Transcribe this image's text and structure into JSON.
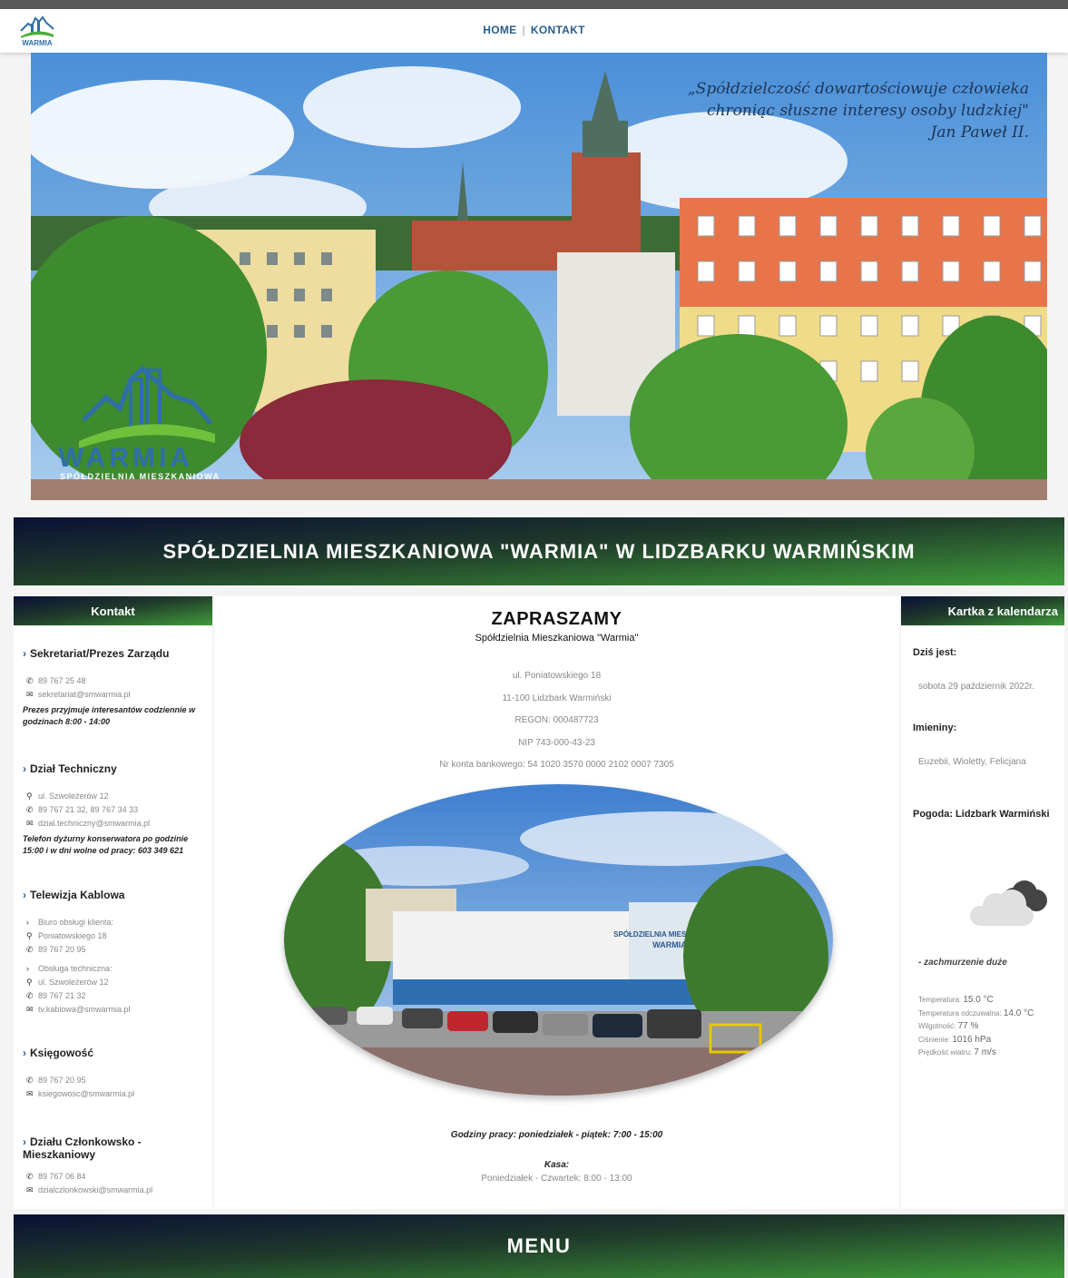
{
  "nav": {
    "home": "HOME",
    "kontakt": "KONTAKT",
    "logo_text": "WARMIA"
  },
  "hero": {
    "quote_line1": "„Spółdzielczość dowartościowuje człowieka",
    "quote_line2": "chroniąc słuszne interesy osoby ludzkiej\"",
    "quote_author": "Jan Paweł II.",
    "logo_text": "WARMIA",
    "logo_sub": "SPÓŁDZIELNIA MIESZKANIOWA"
  },
  "banner": {
    "title": "SPÓŁDZIELNIA MIESZKANIOWA \"WARMIA\" W LIDZBARKU WARMIŃSKIM"
  },
  "left": {
    "header": "Kontakt",
    "sections": [
      {
        "title": "Sekretariat/Prezes Zarządu",
        "phone": "89 767 25 48",
        "email": "sekretariat@smwarmia.pl",
        "note": "Prezes przyjmuje interesantów codziennie w godzinach 8:00 - 14:00"
      },
      {
        "title": "Dział Techniczny",
        "address": "ul. Szwoleżerów 12",
        "phone": "89 767 21 32, 89 767 34 33",
        "email": "dzial.techniczny@smwarmia.pl",
        "note": "Telefon dyżurny konserwatora po godzinie 15:00 i w dni wolne od pracy: 603 349 621"
      },
      {
        "title": "Telewizja Kablowa",
        "sub1": "Biuro obsługi klienta:",
        "address1": "Poniatowskiego 18",
        "phone1": "89 767 20 95",
        "sub2": "Obsługa techniczna:",
        "address2": "ul. Szwoleżerów 12",
        "phone2": "89 767 21 32",
        "email": "tv.kablowa@smwarmia.pl"
      },
      {
        "title": "Księgowość",
        "phone": "89 767 20 95",
        "email": "ksiegowosc@smwarmia.pl"
      },
      {
        "title": "Działu Członkowsko - Mieszkaniowy",
        "phone": "89 767 06 84",
        "email": "dzialczlonkowski@smwarmia.pl"
      }
    ]
  },
  "main": {
    "title": "ZAPRASZAMY",
    "subtitle": "Spółdzielnia Mieszkaniowa \"Warmia\"",
    "info": [
      "ul. Poniatowskiego 18",
      "11-100 Lidzbark Warmiński",
      "REGON: 000487723",
      "NIP 743-000-43-23",
      "Nr konta bankowego: 54 1020 3570 0000 2102 0007 7305"
    ],
    "photo_sign1": "SPÓŁDZIELNIA MIESZKANIOWA",
    "photo_sign2": "WARMIA",
    "hours": "Godziny pracy: poniedziałek - piątek: 7:00 - 15:00",
    "kasa_label": "Kasa:",
    "kasa_hours": "Poniedziałek - Czwartek: 8:00 - 13:00"
  },
  "right": {
    "header": "Kartka z kalendarza",
    "today_label": "Dziś jest:",
    "today_value": "sobota 29 październik 2022r.",
    "names_label": "Imieniny:",
    "names_value": "Euzebii, Wioletty, Felicjana",
    "weather_label": "Pogoda: Lidzbark Warmiński",
    "weather_icon": "cloud-icon",
    "weather_desc": "- zachmurzenie duże",
    "stats": [
      {
        "label": "Temperatura:",
        "value": "15.0 °C"
      },
      {
        "label": "Temperatura odczuwalna:",
        "value": "14.0 °C"
      },
      {
        "label": "Wilgotność:",
        "value": "77 %"
      },
      {
        "label": "Ciśnienie:",
        "value": "1016 hPa"
      },
      {
        "label": "Prędkość wiatru:",
        "value": "7 m/s"
      }
    ]
  },
  "menu": {
    "label": "MENU"
  }
}
